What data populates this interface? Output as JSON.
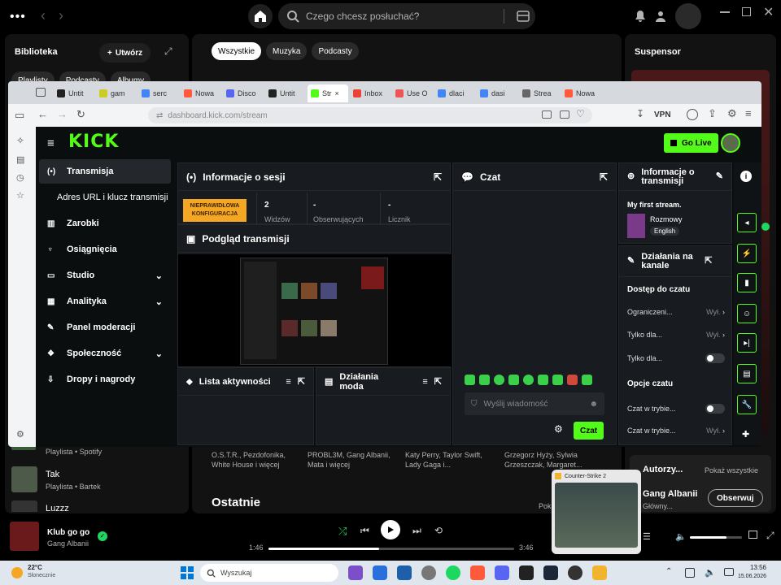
{
  "spotify": {
    "search_placeholder": "Czego chcesz posłuchać?",
    "library": {
      "title": "Biblioteka",
      "create_label": "Utwórz",
      "filters": [
        "Playlisty",
        "Podcasty",
        "Albumy"
      ]
    },
    "main_filters": [
      "Wszystkie",
      "Muzyka",
      "Podcasty"
    ],
    "right_title": "Suspensor",
    "library_items": [
      {
        "title": "Playlista • Spotify",
        "subtitle": ""
      },
      {
        "title": "Tak",
        "subtitle": "Playlista • Bartek"
      },
      {
        "title": "Luzzz",
        "subtitle": ""
      }
    ],
    "bottom_cards": [
      "O.S.T.R., Pezdofonika, White House i więcej",
      "PROBL3M, Gang Albanii, Mata i więcej",
      "Katy Perry, Taylor Swift, Lady Gaga i...",
      "Grzegorz Hyży, Sylwia Grzeszczak, Margaret..."
    ],
    "recent_title": "Ostatnie",
    "recent_more": "Pokaż",
    "authors_title": "Autorzy...",
    "authors_more": "Pokaż wszystkie",
    "artist_name": "Gang Albanii",
    "artist_role": "Główny...",
    "follow_label": "Obserwuj",
    "now_playing": {
      "title": "Klub go go",
      "artist": "Gang Albanii",
      "elapsed": "1:46",
      "total": "3:46",
      "progress_fraction": 0.45
    },
    "volume_fraction": 0.7,
    "thumbnail_title": "Counter-Strike 2"
  },
  "taskbar": {
    "weather_temp": "22°C",
    "weather_desc": "Słonecznie",
    "search_placeholder": "Wyszukaj",
    "time": "13:56",
    "date": "15.06.2026"
  },
  "browser": {
    "tabs": [
      "Untit",
      "gam",
      "serc",
      "Nowa",
      "Disco",
      "Untit",
      "Str",
      "Inbox",
      "Use O",
      "dlaci",
      "dasi",
      "Strea",
      "Nowa"
    ],
    "url": "dashboard.kick.com/stream",
    "vpn_label": "VPN"
  },
  "kick": {
    "logo": "KICK",
    "go_live_label": "Go Live",
    "nav": [
      {
        "label": "Transmisja",
        "icon": "broadcast-icon"
      },
      {
        "label": "Adres URL i klucz transmisji",
        "icon": ""
      },
      {
        "label": "Zarobki",
        "icon": "earnings-icon"
      },
      {
        "label": "Osiągnięcia",
        "icon": "trophy-icon"
      },
      {
        "label": "Studio",
        "icon": "studio-icon"
      },
      {
        "label": "Analityka",
        "icon": "analytics-icon"
      },
      {
        "label": "Panel moderacji",
        "icon": "wrench-icon"
      },
      {
        "label": "Społeczność",
        "icon": "community-icon"
      },
      {
        "label": "Dropy i nagrody",
        "icon": "gift-icon"
      }
    ],
    "session": {
      "title": "Informacje o sesji",
      "badge": "NIEPRAWIDŁOWA KONFIGURACJA",
      "stats": [
        {
          "value": "2",
          "label": "Widzów"
        },
        {
          "value": "-",
          "label": "Obserwujących"
        },
        {
          "value": "-",
          "label": "Licznik"
        }
      ]
    },
    "preview_title": "Podgląd transmisji",
    "activity_title": "Lista aktywności",
    "mod_title": "Działania moda",
    "chat": {
      "title": "Czat",
      "placeholder": "Wyślij wiadomość",
      "send_label": "Czat"
    },
    "stream_info": {
      "title": "Informacje o transmisji",
      "stream_title": "My first stream.",
      "category": "Rozmowy",
      "language": "English"
    },
    "channel": {
      "title": "Działania na kanale",
      "chat_access": "Dostęp do czatu",
      "rows": [
        {
          "label": "Ograniczeni...",
          "value": "Wył."
        },
        {
          "label": "Tylko dla...",
          "value": "Wył."
        },
        {
          "label": "Tylko dla...",
          "value": ""
        }
      ],
      "chat_options": "Opcje czatu",
      "rows2": [
        {
          "label": "Czat w trybie...",
          "value": ""
        },
        {
          "label": "Czat w trybie...",
          "value": "Wył."
        }
      ]
    }
  }
}
